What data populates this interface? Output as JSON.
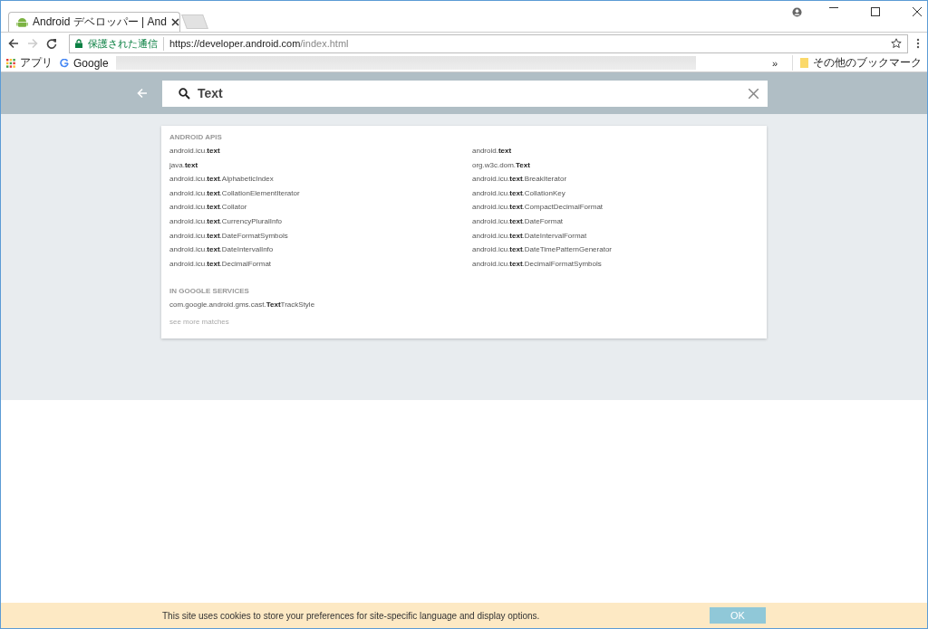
{
  "browser": {
    "tab_title": "Android デベロッパー | And",
    "address_secure_label": "保護された通信",
    "address_host": "https://developer.android.com",
    "address_path": "/index.html",
    "bookmarks": [
      {
        "kind": "apps",
        "label": "アプリ"
      },
      {
        "kind": "google",
        "label": "Google"
      }
    ],
    "bookmarks_overflow": "»",
    "other_bookmarks": "その他のブックマーク"
  },
  "search": {
    "value": "Text"
  },
  "results": {
    "sections": [
      {
        "heading": "ANDROID APIS",
        "items": [
          "android.icu.**text**",
          "android.**text**",
          "java.**text**",
          "org.w3c.dom.**Text**",
          "android.icu.**text**.AlphabeticIndex",
          "android.icu.**text**.BreakIterator",
          "android.icu.**text**.CollationElementIterator",
          "android.icu.**text**.CollationKey",
          "android.icu.**text**.Collator",
          "android.icu.**text**.CompactDecimalFormat",
          "android.icu.**text**.CurrencyPluralInfo",
          "android.icu.**text**.DateFormat",
          "android.icu.**text**.DateFormatSymbols",
          "android.icu.**text**.DateIntervalFormat",
          "android.icu.**text**.DateIntervalInfo",
          "android.icu.**text**.DateTimePatternGenerator",
          "android.icu.**text**.DecimalFormat",
          "android.icu.**text**.DecimalFormatSymbols"
        ]
      },
      {
        "heading": "IN GOOGLE SERVICES",
        "items": [
          "com.google.android.gms.cast.**Text**TrackStyle"
        ]
      }
    ],
    "more_link": "see more matches"
  },
  "cookie_bar": {
    "message": "This site uses cookies to store your preferences for site-specific language and display options.",
    "button": "OK"
  }
}
